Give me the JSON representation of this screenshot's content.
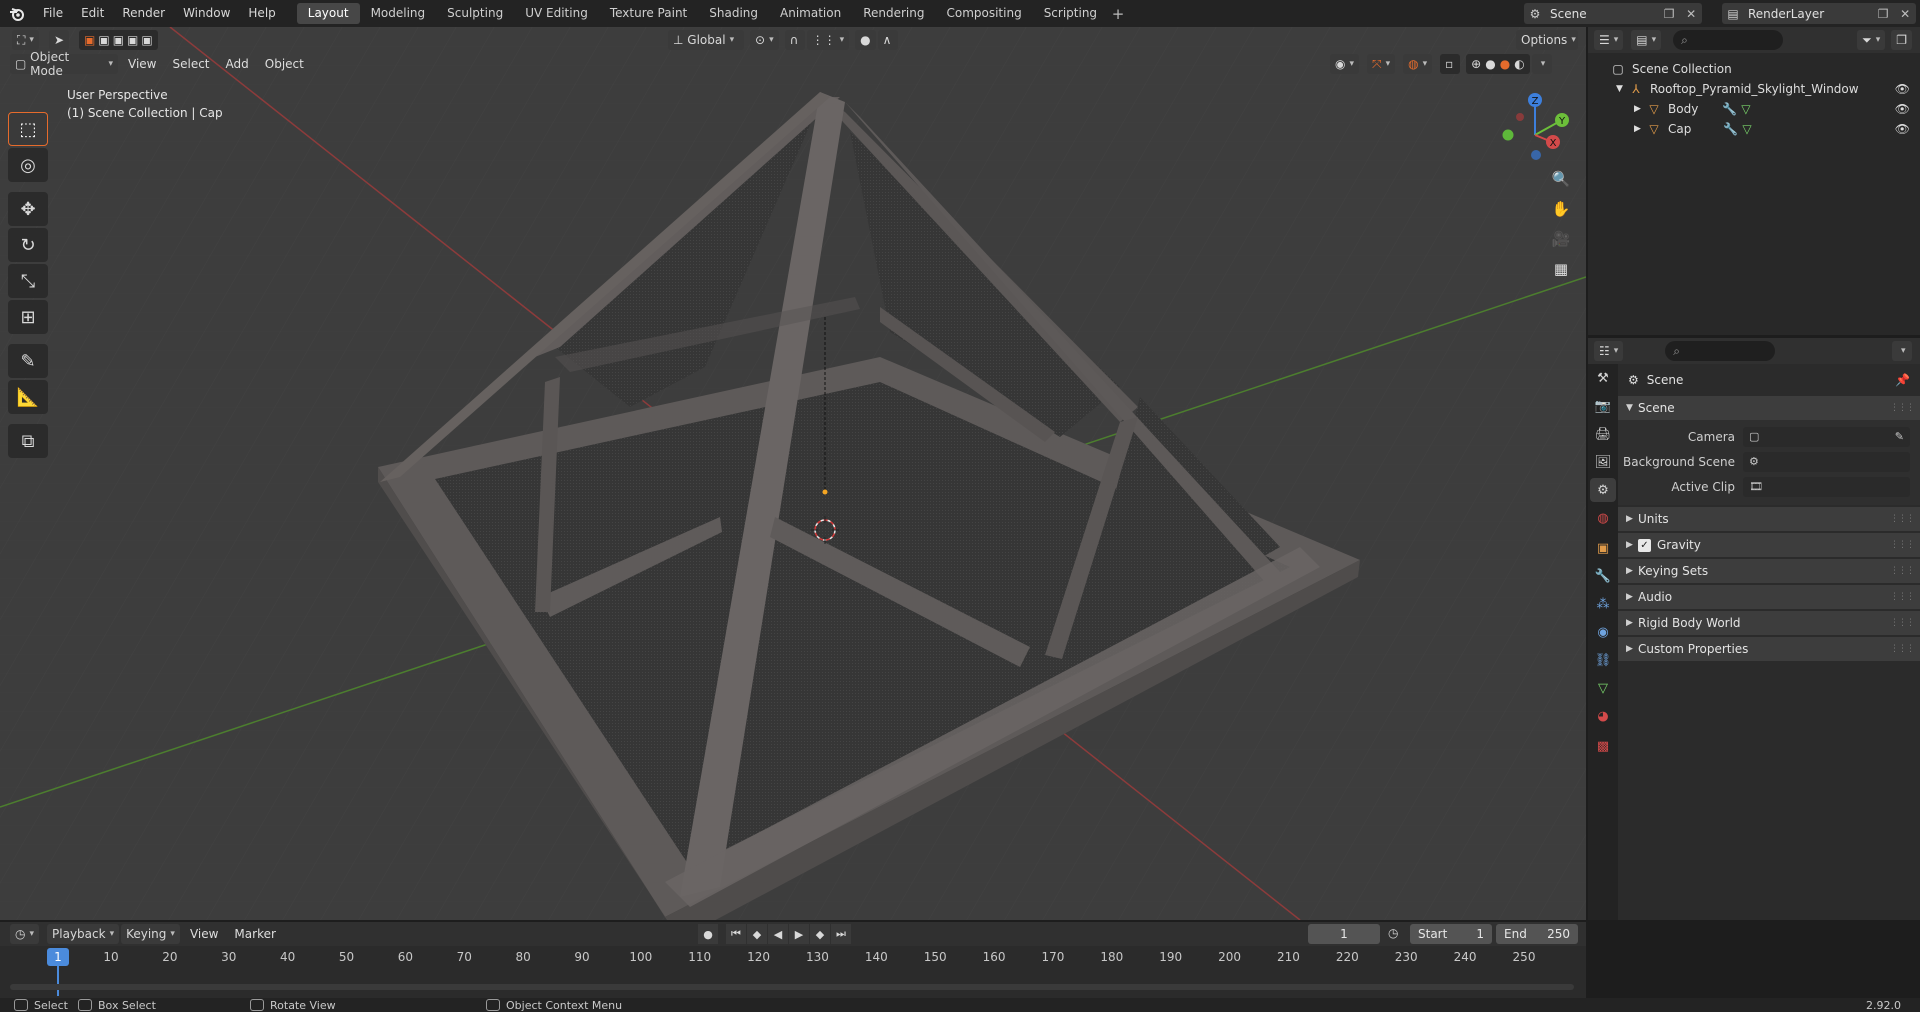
{
  "topbar": {
    "menus": [
      "File",
      "Edit",
      "Render",
      "Window",
      "Help"
    ],
    "workspaces": [
      "Layout",
      "Modeling",
      "Sculpting",
      "UV Editing",
      "Texture Paint",
      "Shading",
      "Animation",
      "Rendering",
      "Compositing",
      "Scripting"
    ],
    "active_workspace": "Layout",
    "add_workspace": "+",
    "scene_name": "Scene",
    "view_layer": "RenderLayer"
  },
  "viewport": {
    "mode": "Object Mode",
    "menus": [
      "View",
      "Select",
      "Add",
      "Object"
    ],
    "orientation": "Global",
    "options_label": "Options",
    "info_line1": "User Perspective",
    "info_line2": "(1) Scene Collection | Cap",
    "gizmo": {
      "x": "X",
      "y": "Y",
      "z": "Z"
    }
  },
  "outliner": {
    "root": "Scene Collection",
    "collection": "Rooftop_Pyramid_Skylight_Window",
    "objects": [
      "Body",
      "Cap"
    ]
  },
  "properties": {
    "context": "Scene",
    "panel_title": "Scene",
    "fields": [
      {
        "label": "Camera"
      },
      {
        "label": "Background Scene"
      },
      {
        "label": "Active Clip"
      }
    ],
    "subpanels": [
      "Units",
      "Gravity",
      "Keying Sets",
      "Audio",
      "Rigid Body World",
      "Custom Properties"
    ],
    "gravity_checked": true
  },
  "timeline": {
    "menus": [
      "Playback",
      "Keying",
      "View",
      "Marker"
    ],
    "current_frame": "1",
    "start_label": "Start",
    "start_value": "1",
    "end_label": "End",
    "end_value": "250",
    "ticks": [
      "1",
      "10",
      "20",
      "30",
      "40",
      "50",
      "60",
      "70",
      "80",
      "90",
      "100",
      "110",
      "120",
      "130",
      "140",
      "150",
      "160",
      "170",
      "180",
      "190",
      "200",
      "210",
      "220",
      "230",
      "240",
      "250"
    ]
  },
  "statusbar": {
    "select": "Select",
    "box_select": "Box Select",
    "rotate_view": "Rotate View",
    "context_menu": "Object Context Menu",
    "version": "2.92.0"
  },
  "colors": {
    "accent": "#e66b2c",
    "active_blue": "#4b8bdc",
    "axis_x": "#d34a4a",
    "axis_y": "#6cbf3a",
    "axis_z": "#3d7fdc"
  }
}
